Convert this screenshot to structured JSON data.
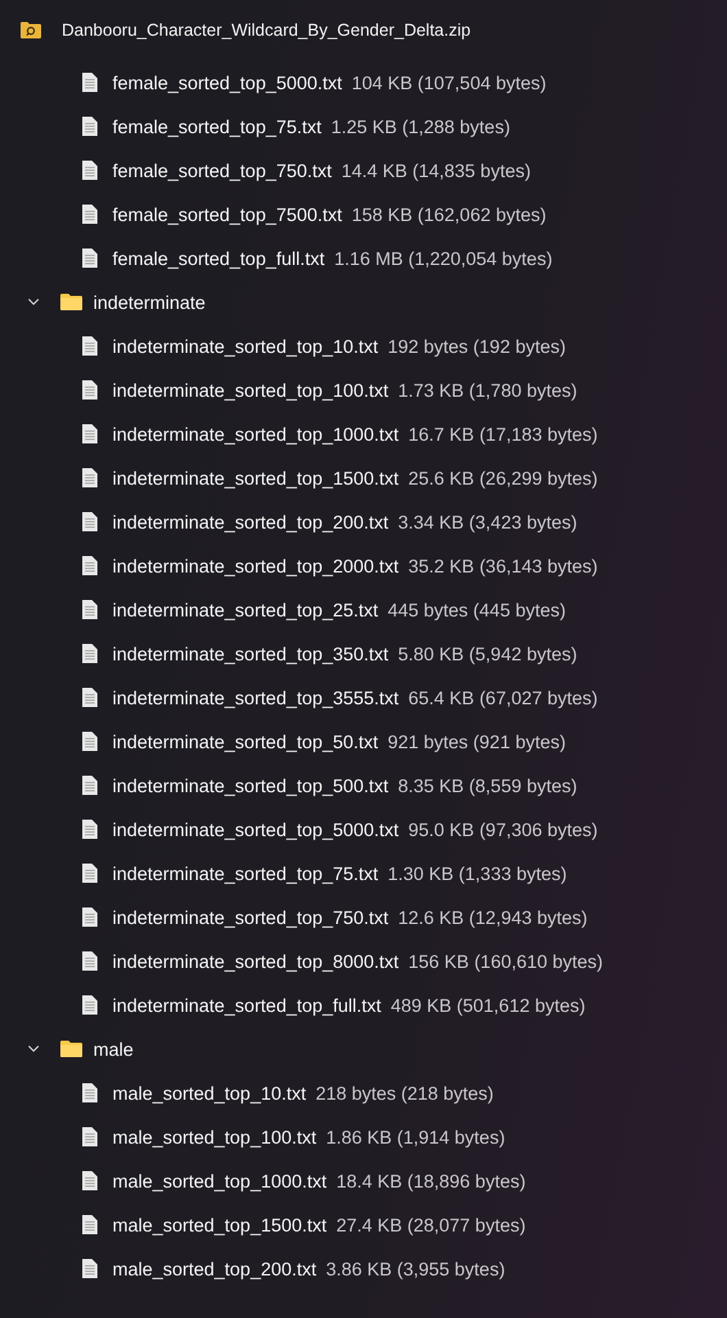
{
  "archive": {
    "name": "Danbooru_Character_Wildcard_By_Gender_Delta.zip",
    "children": [
      {
        "kind": "continued",
        "children": [
          {
            "name": "female_sorted_top_5000.txt",
            "size": "104 KB (107,504 bytes)"
          },
          {
            "name": "female_sorted_top_75.txt",
            "size": "1.25 KB (1,288 bytes)"
          },
          {
            "name": "female_sorted_top_750.txt",
            "size": "14.4 KB (14,835 bytes)"
          },
          {
            "name": "female_sorted_top_7500.txt",
            "size": "158 KB (162,062 bytes)"
          },
          {
            "name": "female_sorted_top_full.txt",
            "size": "1.16 MB (1,220,054 bytes)"
          }
        ]
      },
      {
        "kind": "folder",
        "name": "indeterminate",
        "expanded": true,
        "children": [
          {
            "name": "indeterminate_sorted_top_10.txt",
            "size": "192 bytes (192 bytes)"
          },
          {
            "name": "indeterminate_sorted_top_100.txt",
            "size": "1.73 KB (1,780 bytes)"
          },
          {
            "name": "indeterminate_sorted_top_1000.txt",
            "size": "16.7 KB (17,183 bytes)"
          },
          {
            "name": "indeterminate_sorted_top_1500.txt",
            "size": "25.6 KB (26,299 bytes)"
          },
          {
            "name": "indeterminate_sorted_top_200.txt",
            "size": "3.34 KB (3,423 bytes)"
          },
          {
            "name": "indeterminate_sorted_top_2000.txt",
            "size": "35.2 KB (36,143 bytes)"
          },
          {
            "name": "indeterminate_sorted_top_25.txt",
            "size": "445 bytes (445 bytes)"
          },
          {
            "name": "indeterminate_sorted_top_350.txt",
            "size": "5.80 KB (5,942 bytes)"
          },
          {
            "name": "indeterminate_sorted_top_3555.txt",
            "size": "65.4 KB (67,027 bytes)"
          },
          {
            "name": "indeterminate_sorted_top_50.txt",
            "size": "921 bytes (921 bytes)"
          },
          {
            "name": "indeterminate_sorted_top_500.txt",
            "size": "8.35 KB (8,559 bytes)"
          },
          {
            "name": "indeterminate_sorted_top_5000.txt",
            "size": "95.0 KB (97,306 bytes)"
          },
          {
            "name": "indeterminate_sorted_top_75.txt",
            "size": "1.30 KB (1,333 bytes)"
          },
          {
            "name": "indeterminate_sorted_top_750.txt",
            "size": "12.6 KB (12,943 bytes)"
          },
          {
            "name": "indeterminate_sorted_top_8000.txt",
            "size": "156 KB (160,610 bytes)"
          },
          {
            "name": "indeterminate_sorted_top_full.txt",
            "size": "489 KB (501,612 bytes)"
          }
        ]
      },
      {
        "kind": "folder",
        "name": "male",
        "expanded": true,
        "children": [
          {
            "name": "male_sorted_top_10.txt",
            "size": "218 bytes (218 bytes)"
          },
          {
            "name": "male_sorted_top_100.txt",
            "size": "1.86 KB (1,914 bytes)"
          },
          {
            "name": "male_sorted_top_1000.txt",
            "size": "18.4 KB (18,896 bytes)"
          },
          {
            "name": "male_sorted_top_1500.txt",
            "size": "27.4 KB (28,077 bytes)"
          },
          {
            "name": "male_sorted_top_200.txt",
            "size": "3.86 KB (3,955 bytes)"
          }
        ]
      }
    ]
  }
}
